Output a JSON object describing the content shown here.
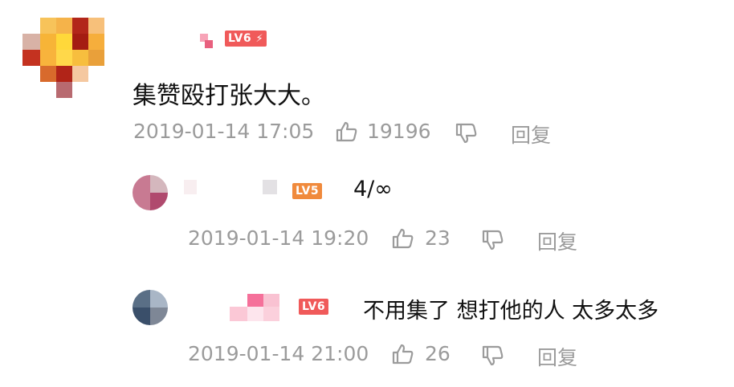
{
  "comments": [
    {
      "level": "LV6",
      "text": "集赞殴打张大大。",
      "timestamp": "2019-01-14 17:05",
      "likes": "19196",
      "reply_label": "回复"
    }
  ],
  "replies": [
    {
      "level": "LV5",
      "text": "4/∞",
      "timestamp": "2019-01-14 19:20",
      "likes": "23",
      "reply_label": "回复"
    },
    {
      "level": "LV6",
      "text": "不用集了  想打他的人 太多太多",
      "timestamp": "2019-01-14 21:00",
      "likes": "26",
      "reply_label": "回复"
    }
  ],
  "colors": {
    "meta": "#9b9b9b",
    "lv6": "#f05a5a",
    "lv5": "#f08a3c"
  },
  "icons": [
    "thumbs-up-icon",
    "thumbs-down-icon",
    "bolt-icon"
  ]
}
